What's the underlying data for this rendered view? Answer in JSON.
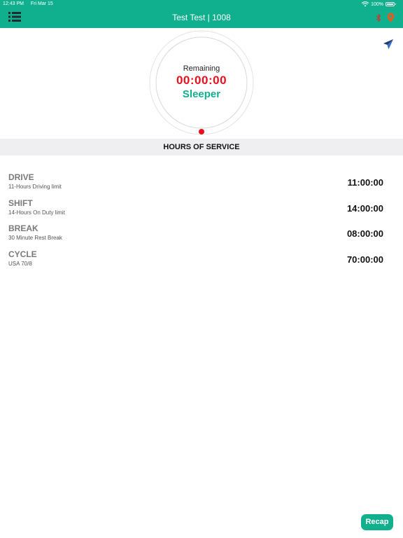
{
  "status_bar": {
    "time": "12:43 PM",
    "date": "Fri Mar 15",
    "battery": "100%"
  },
  "header": {
    "title": "Test Test | 1008"
  },
  "colors": {
    "brand": "#10b08f",
    "timer": "#e8101e",
    "location_icon": "#e85a1f"
  },
  "icons": [
    "menu-icon",
    "bluetooth-icon",
    "location-pin-icon",
    "send-icon",
    "wifi-icon",
    "battery-icon"
  ],
  "dial": {
    "label": "Remaining",
    "timer": "00:00:00",
    "status": "Sleeper"
  },
  "section": {
    "title": "HOURS OF SERVICE"
  },
  "hours": [
    {
      "title": "DRIVE",
      "subtitle": "11-Hours Driving limit",
      "value": "11:00:00"
    },
    {
      "title": "SHIFT",
      "subtitle": "14-Hours On Duty limit",
      "value": "14:00:00"
    },
    {
      "title": "BREAK",
      "subtitle": "30 Minute Rest Break",
      "value": "08:00:00"
    },
    {
      "title": "CYCLE",
      "subtitle": "USA 70/8",
      "value": "70:00:00"
    }
  ],
  "recap_button": {
    "label": "Recap"
  }
}
